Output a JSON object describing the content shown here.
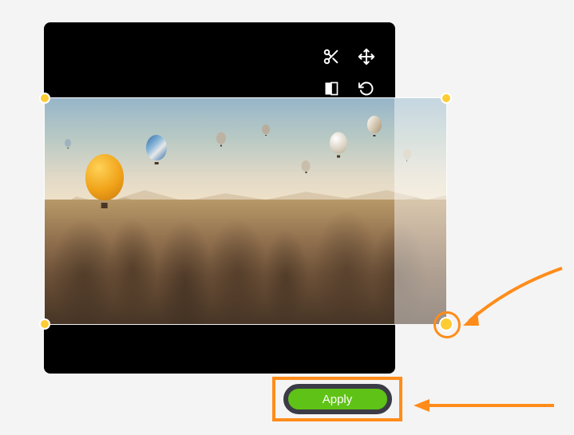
{
  "toolbar": {
    "crop_icon": "crop-icon",
    "move_icon": "move-icon",
    "aspect_icon": "aspect-icon",
    "rotate_icon": "rotate-icon"
  },
  "actions": {
    "apply_label": "Apply"
  },
  "annotations": {
    "highlight_color": "#ff8c1a"
  }
}
